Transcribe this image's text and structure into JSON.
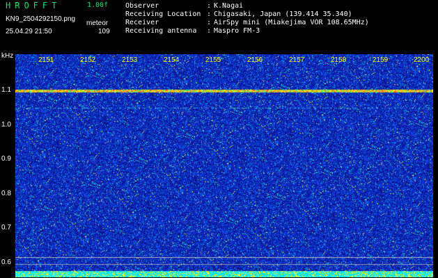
{
  "header": {
    "app_title": "HROFFT",
    "version": "1.00f",
    "filename": "KN9_2504292150.png",
    "mode": "meteor",
    "datetime": "25.04.29 21:50",
    "count": "109"
  },
  "info": [
    {
      "label": "Observer",
      "value": "K.Nagai"
    },
    {
      "label": "Receiving Location",
      "value": "Chigasaki, Japan (139.414 35.340)"
    },
    {
      "label": "Receiver",
      "value": "AirSpy mini (Miakejima VOR 108.65MHz)"
    },
    {
      "label": "Receiving antenna",
      "value": "Maspro FM-3"
    }
  ],
  "axis": {
    "unit": "kHz",
    "y_ticks": [
      "1.1",
      "1.0",
      "0.9",
      "0.8",
      "0.7",
      "0.6"
    ],
    "x_ticks": [
      "2151",
      "2152",
      "2153",
      "2154",
      "2155",
      "2156",
      "2157",
      "2158",
      "2159",
      "2200"
    ]
  },
  "colors": {
    "background_noise": "#1a2fc0",
    "carrier_line": "#ffe600",
    "title": "#00e676"
  }
}
